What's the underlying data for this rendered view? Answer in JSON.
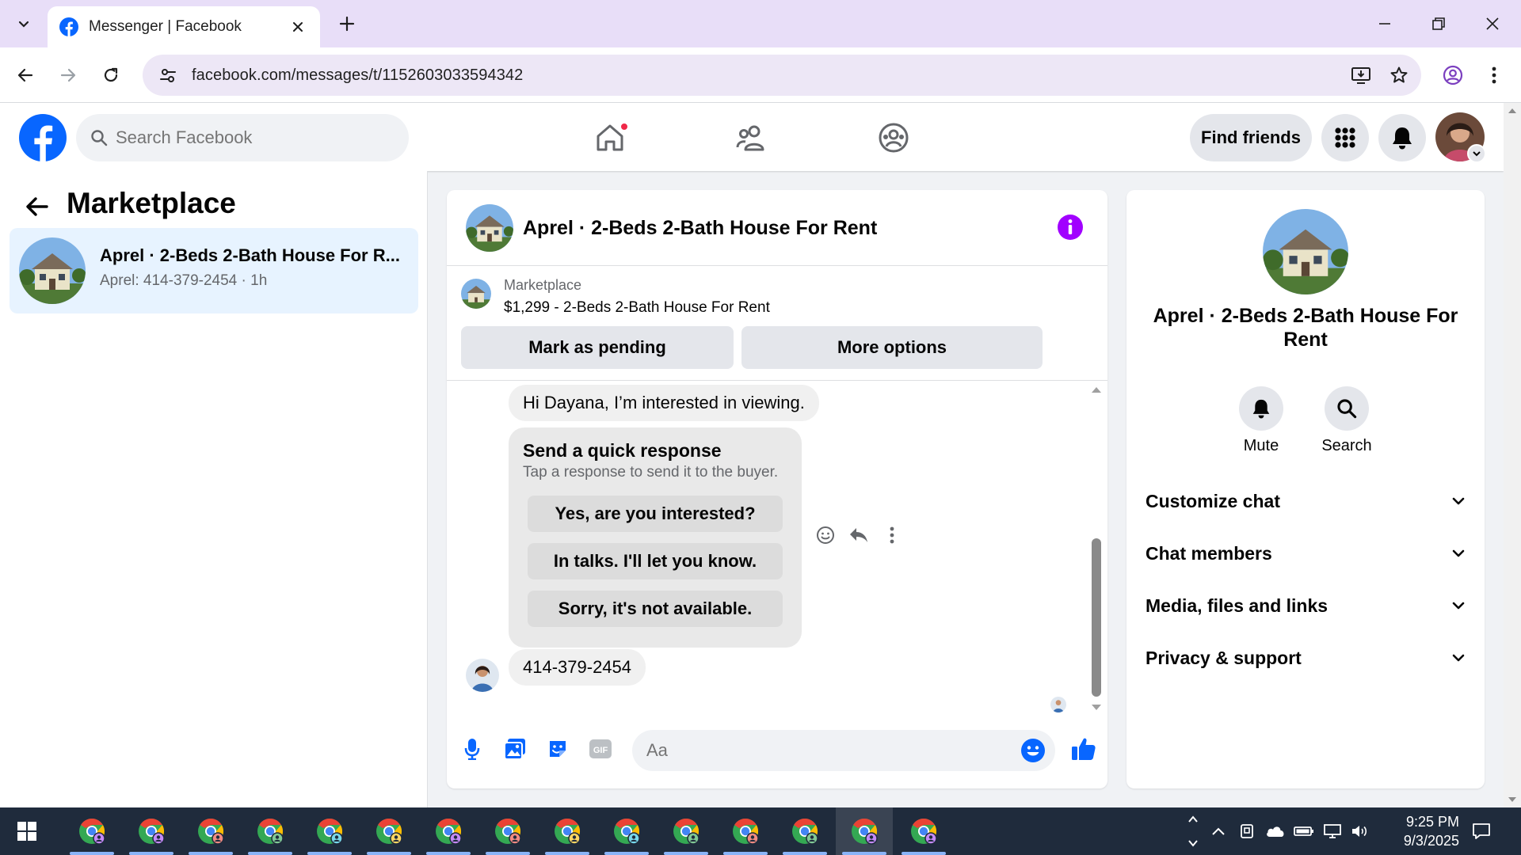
{
  "browser": {
    "tab_title": "Messenger | Facebook",
    "url": "facebook.com/messages/t/1152603033594342"
  },
  "fb_header": {
    "search_placeholder": "Search Facebook",
    "find_friends_label": "Find friends"
  },
  "sidebar": {
    "title": "Marketplace",
    "conversation": {
      "title": "Aprel · 2-Beds 2-Bath House For R...",
      "subtitle": "Aprel: 414-379-2454 · 1h"
    }
  },
  "chat": {
    "header_title": "Aprel · 2-Beds 2-Bath House For Rent",
    "listing_label": "Marketplace",
    "listing_item": "$1,299 - 2-Beds 2-Bath House For Rent",
    "mark_pending_label": "Mark as pending",
    "more_options_label": "More options",
    "messages": [
      {
        "text": "Hi Dayana, I’m interested in viewing."
      },
      {
        "text": "414-379-2454"
      }
    ],
    "quick_response": {
      "title": "Send a quick response",
      "subtitle": "Tap a response to send it to the buyer.",
      "options": [
        "Yes, are you interested?",
        "In talks. I'll let you know.",
        "Sorry, it's not available."
      ]
    },
    "composer_placeholder": "Aa"
  },
  "info_panel": {
    "title": "Aprel · 2-Beds 2-Bath House For Rent",
    "mute_label": "Mute",
    "search_label": "Search",
    "sections": [
      "Customize chat",
      "Chat members",
      "Media, files and links",
      "Privacy & support"
    ]
  },
  "taskbar": {
    "time": "9:25 PM",
    "date": "9/3/2025"
  },
  "colors": {
    "accent": "#0866ff",
    "info_purple": "#a100ff",
    "tab_strip": "#e8def8",
    "selected_conv": "#e7f3ff",
    "notification_dot": "#f02849",
    "taskbar": "#1f2b3c"
  },
  "icons": [
    "chevron-down-icon",
    "facebook-logo-icon",
    "close-icon",
    "plus-icon",
    "minimize-icon",
    "restore-icon",
    "back-icon",
    "forward-icon",
    "reload-icon",
    "site-info-icon",
    "install-icon",
    "star-icon",
    "profile-icon",
    "kebab-icon",
    "search-icon",
    "home-icon",
    "friends-icon",
    "groups-icon",
    "apps-grid-icon",
    "bell-icon",
    "info-icon",
    "emoji-icon",
    "reply-icon",
    "more-icon",
    "mic-icon",
    "photo-icon",
    "sticker-icon",
    "gif-icon",
    "smile-icon",
    "like-icon",
    "windows-start-icon",
    "chrome-icon"
  ]
}
